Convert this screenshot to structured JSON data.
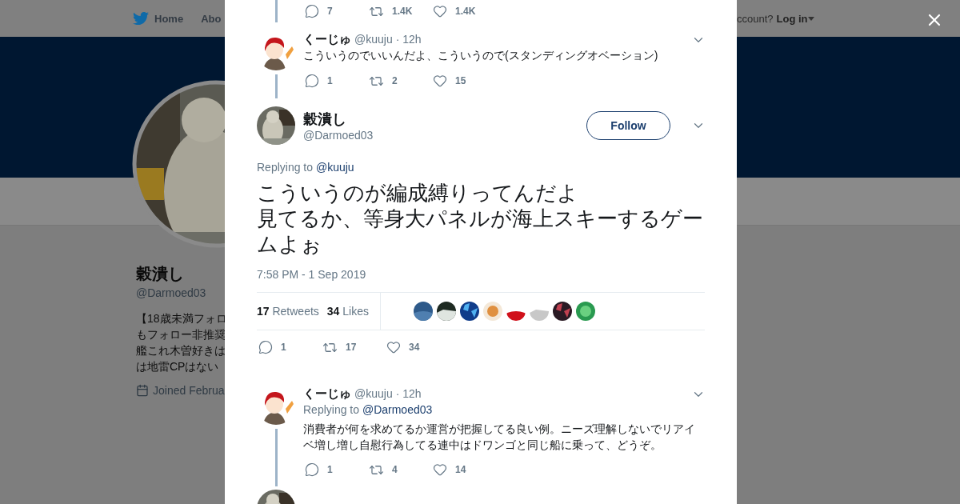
{
  "background_page": {
    "nav": {
      "home": "Home",
      "about": "Abo",
      "account_prompt": "ccount?",
      "login": "Log in"
    },
    "profile": {
      "name": "穀潰し",
      "handle": "@Darmoed03",
      "bio_lines": [
        "【18歳未満フォロ",
        "もフォロー非推奨",
        "艦これ木曽好きは",
        "は地雷CPはない"
      ],
      "joined": "Joined Februa"
    }
  },
  "modal": {
    "thread_above": [
      {
        "kind": "actions_only",
        "replies": "7",
        "retweets": "1.4K",
        "likes": "1.4K"
      },
      {
        "kind": "tweet",
        "name": "くーじゅ",
        "handle": "@kuuju",
        "time": "· 12h",
        "text": "こういうのでいいんだよ、こういうので(スタンディングオベーション)",
        "replies": "1",
        "retweets": "2",
        "likes": "15"
      }
    ],
    "main_tweet": {
      "name": "穀潰し",
      "handle": "@Darmoed03",
      "follow_label": "Follow",
      "replying_label": "Replying to",
      "replying_to": "@kuuju",
      "text_lines": [
        "こういうのが編成縛りってんだよ",
        "見てるか、等身大パネルが海上スキーするゲームよぉ"
      ],
      "timestamp": "7:58 PM - 1 Sep 2019",
      "retweet_count": "17",
      "retweet_label": "Retweets",
      "like_count": "34",
      "like_label": "Likes",
      "replies": "1",
      "retweets": "17",
      "likes": "34"
    },
    "replies": [
      {
        "kind": "tweet",
        "name": "くーじゅ",
        "handle": "@kuuju",
        "time": "· 12h",
        "replying_label": "Replying to",
        "replying_to": "@Darmoed03",
        "text": "消費者が何を求めてるか運営が把握してる良い例。ニーズ理解しないでリアイベ増し増し自慰行為してる連中はドワンゴと同じ船に乗って、どうぞ。",
        "replies": "1",
        "retweets": "4",
        "likes": "14"
      },
      {
        "kind": "partial"
      }
    ]
  }
}
